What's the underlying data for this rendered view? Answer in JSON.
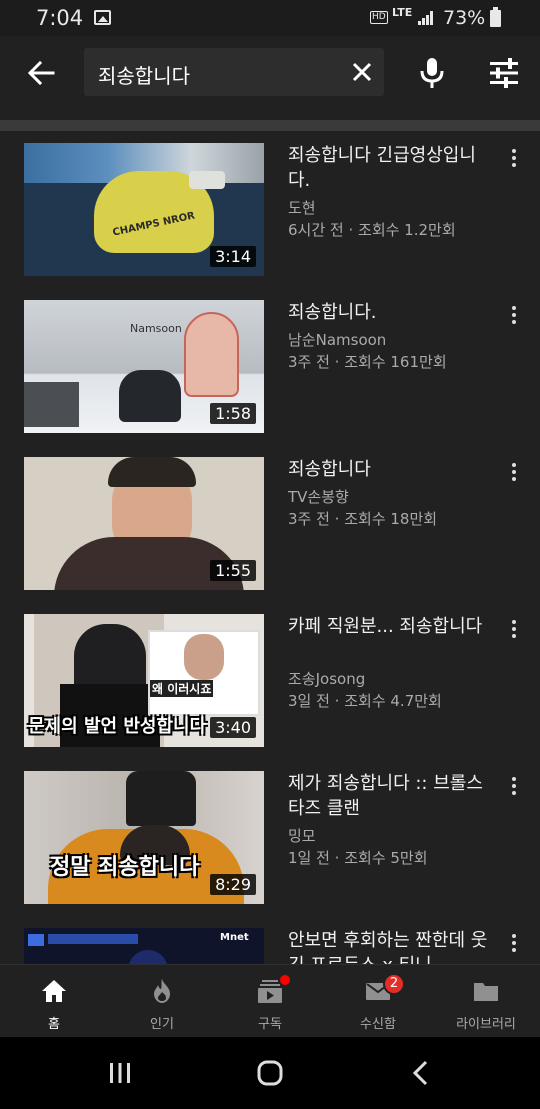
{
  "status_bar": {
    "time": "7:04",
    "hd": "HD",
    "network": "LTE",
    "battery": "73%"
  },
  "search": {
    "query": "죄송합니다"
  },
  "videos": [
    {
      "title": "죄송합니다 긴급영상입니다.",
      "channel": "도현",
      "meta": "6시간 전 · 조회수 1.2만회",
      "duration": "3:14",
      "caption": "",
      "thumb_text": "CHAMPS NROR"
    },
    {
      "title": "죄송합니다.",
      "channel": "남순Namsoon",
      "meta": "3주 전 · 조회수 161만회",
      "duration": "1:58",
      "caption": "",
      "thumb_text": "Namsoon"
    },
    {
      "title": "죄송합니다",
      "channel": "TV손봉향",
      "meta": "3주 전 · 조회수 18만회",
      "duration": "1:55",
      "caption": "",
      "thumb_text": ""
    },
    {
      "title": "카페 직원분... 죄송합니다",
      "channel": "조송Josong",
      "meta": "3일 전 · 조회수 4.7만회",
      "duration": "3:40",
      "caption": "문제의 발언 반성합니다",
      "thumb_text": "왜 이러시죠"
    },
    {
      "title": "제가 죄송합니다 :: 브롤스타즈 클랜",
      "channel": "밍모",
      "meta": "1일 전 · 조회수 5만회",
      "duration": "8:29",
      "caption": "정말 죄송합니다",
      "thumb_text": ""
    },
    {
      "title": "안보면 후회하는 짠한데 웃긴 프로듀스 x 티니",
      "channel": "",
      "meta": "",
      "duration": "",
      "caption": "",
      "thumb_text": "Mnet"
    }
  ],
  "bottom_nav": [
    {
      "label": "홈",
      "icon": "home-icon",
      "active": true
    },
    {
      "label": "인기",
      "icon": "fire-icon",
      "active": false
    },
    {
      "label": "구독",
      "icon": "subscriptions-icon",
      "active": false,
      "dot": true
    },
    {
      "label": "수신함",
      "icon": "mail-icon",
      "active": false,
      "badge": "2"
    },
    {
      "label": "라이브러리",
      "icon": "folder-icon",
      "active": false
    }
  ],
  "colors": {
    "background": "#212121",
    "accent_red": "#ff0000",
    "secondary_text": "#aaaaaa"
  }
}
